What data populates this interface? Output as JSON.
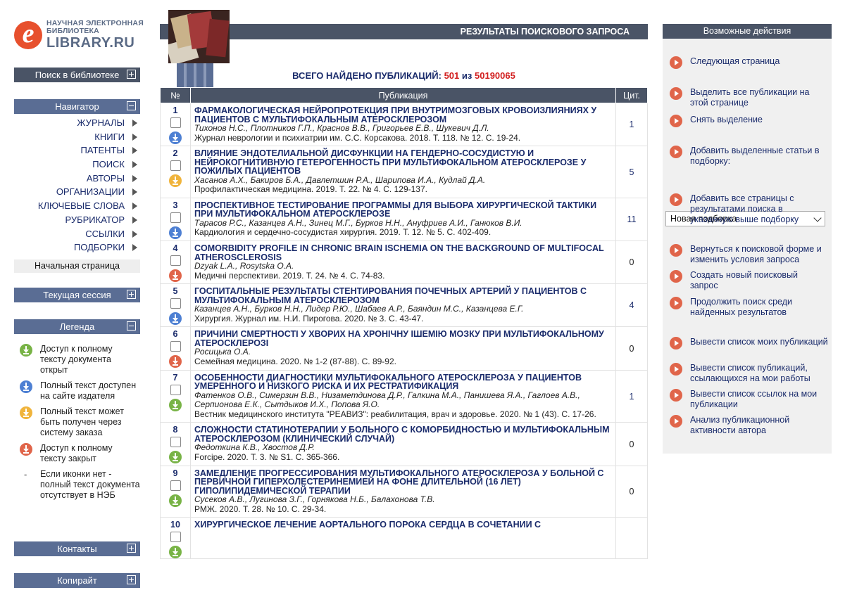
{
  "logo": {
    "line1": "НАУЧНАЯ ЭЛЕКТРОННАЯ",
    "line2": "БИБЛИОТЕКА",
    "brand": "LIBRARY.RU",
    "letter": "e"
  },
  "sidebar": {
    "search": "Поиск в библиотеке",
    "navigator": "Навигатор",
    "nav_items": [
      "ЖУРНАЛЫ",
      "КНИГИ",
      "ПАТЕНТЫ",
      "ПОИСК",
      "АВТОРЫ",
      "ОРГАНИЗАЦИИ",
      "КЛЮЧЕВЫЕ СЛОВА",
      "РУБРИКАТОР",
      "ССЫЛКИ",
      "ПОДБОРКИ"
    ],
    "home": "Начальная страница",
    "session": "Текущая сессия",
    "legend_title": "Легенда",
    "legend": [
      {
        "icon": "green-download-icon",
        "text": "Доступ к полному тексту документа открыт"
      },
      {
        "icon": "blue-download-icon",
        "text": "Полный текст доступен на сайте издателя"
      },
      {
        "icon": "yellow-download-icon",
        "text": "Полный текст может быть получен через систему заказа"
      },
      {
        "icon": "red-download-icon",
        "text": "Доступ к полному тексту закрыт"
      },
      {
        "icon": "dash",
        "text": "Если иконки нет - полный текст документа отсутствует в НЭБ",
        "mark": "-"
      }
    ],
    "contacts": "Контакты",
    "copyright": "Копирайт"
  },
  "main": {
    "header": "РЕЗУЛЬТАТЫ ПОИСКОВОГО ЗАПРОСА",
    "total_label": "ВСЕГО НАЙДЕНО ПУБЛИКАЦИЙ:",
    "total_found": "501",
    "of": "из",
    "total_all": "50190065",
    "columns": {
      "num": "№",
      "pub": "Публикация",
      "cit": "Цит."
    },
    "rows": [
      {
        "num": "1",
        "icon": "b",
        "title": "ФАРМАКОЛОГИЧЕСКАЯ НЕЙРОПРОТЕКЦИЯ ПРИ ВНУТРИМОЗГОВЫХ КРОВОИЗЛИЯНИЯХ У ПАЦИЕНТОВ С МУЛЬТИФОКАЛЬНЫМ АТЕРОСКЛЕРОЗОМ",
        "authors": "Тихонов Н.С., Плотников Г.П., Краснов В.В., Григорьев Е.В., Шукевич Д.Л.",
        "source": "Журнал неврологии и психиатрии им. С.С. Корсакова. 2018. Т. 118. № 12. С. 19-24.",
        "cit": "1"
      },
      {
        "num": "2",
        "icon": "y",
        "title": "ВЛИЯНИЕ ЭНДОТЕЛИАЛЬНОЙ ДИСФУНКЦИИ НА ГЕНДЕРНО-СОСУДИСТУЮ И НЕЙРОКОГНИТИВНУЮ ГЕТЕРОГЕННОСТЬ ПРИ МУЛЬТИФОКАЛЬНОМ АТЕРОСКЛЕРОЗЕ У ПОЖИЛЫХ ПАЦИЕНТОВ",
        "authors": "Хасанов А.Х., Бакиров Б.А., Давлетшин Р.А., Шарипова И.А., Кудлай Д.А.",
        "source": "Профилактическая медицина. 2019. Т. 22. № 4. С. 129-137.",
        "cit": "5"
      },
      {
        "num": "3",
        "icon": "b",
        "title": "ПРОСПЕКТИВНОЕ ТЕСТИРОВАНИЕ ПРОГРАММЫ ДЛЯ ВЫБОРА ХИРУРГИЧЕСКОЙ ТАКТИКИ ПРИ МУЛЬТИФОКАЛЬНОМ АТЕРОСКЛЕРОЗЕ",
        "authors": "Тарасов Р.С., Казанцев А.Н., Зинец М.Г., Бурков Н.Н., Ануфриев А.И., Ганюков В.И.",
        "source": "Кардиология и сердечно-сосудистая хирургия. 2019. Т. 12. № 5. С. 402-409.",
        "cit": "11"
      },
      {
        "num": "4",
        "icon": "r",
        "title": "COMORBIDITY PROFILE IN CHRONIC BRAIN ISCHEMIA ON THE BACKGROUND OF MULTIFOCAL ATHEROSCLEROSIS",
        "authors": "Dzyak L.A., Rosytska O.A.",
        "source": "Медичні перспективи. 2019. Т. 24. № 4. С. 74-83.",
        "cit": "0"
      },
      {
        "num": "5",
        "icon": "b",
        "title": "ГОСПИТАЛЬНЫЕ РЕЗУЛЬТАТЫ СТЕНТИРОВАНИЯ ПОЧЕЧНЫХ АРТЕРИЙ У ПАЦИЕНТОВ С МУЛЬТИФОКАЛЬНЫМ АТЕРОСКЛЕРОЗОМ",
        "authors": "Казанцев А.Н., Бурков Н.Н., Лидер Р.Ю., Шабаев А.Р., Баяндин М.С., Казанцева Е.Г.",
        "source": "Хирургия. Журнал им. Н.И. Пирогова. 2020. № 3. С. 43-47.",
        "cit": "4"
      },
      {
        "num": "6",
        "icon": "r",
        "title": "ПРИЧИНИ СМЕРТНОСТІ У ХВОРИХ НА ХРОНІЧНУ ІШЕМІЮ МОЗКУ ПРИ МУЛЬТИФОКАЛЬНОМУ АТЕРОСКЛЕРОЗІ",
        "authors": "Росицька О.А.",
        "source": "Семейная медицина. 2020. № 1-2 (87-88). С. 89-92.",
        "cit": "0"
      },
      {
        "num": "7",
        "icon": "g",
        "title": "ОСОБЕННОСТИ ДИАГНОСТИКИ МУЛЬТИФОКАЛЬНОГО АТЕРОСКЛЕРОЗА У ПАЦИЕНТОВ УМЕРЕННОГО И НИЗКОГО РИСКА И ИХ РЕСТРАТИФИКАЦИЯ",
        "authors": "Фатенков О.В., Симерзин В.В., Низаметдинова Д.Р., Галкина М.А., Панишева Я.А., Гаглоев А.В., Серпионова Е.К., Сытдыков И.Х., Попова Я.О.",
        "source": "Вестник медицинского института \"РЕАВИЗ\": реабилитация, врач и здоровье. 2020. № 1 (43). С. 17-26.",
        "cit": "1"
      },
      {
        "num": "8",
        "icon": "g",
        "title": "СЛОЖНОСТИ СТАТИНОТЕРАПИИ У БОЛЬНОГО С КОМОРБИДНОСТЬЮ И МУЛЬТИФОКАЛЬНЫМ АТЕРОСКЛЕРОЗОМ (КЛИНИЧЕСКИЙ СЛУЧАЙ)",
        "authors": "Федоткина К.В., Хвостов Д.Р.",
        "source": "Forcipe. 2020. Т. 3. № S1. С. 365-366.",
        "cit": "0"
      },
      {
        "num": "9",
        "icon": "g",
        "title": "ЗАМЕДЛЕНИЕ ПРОГРЕССИРОВАНИЯ МУЛЬТИФОКАЛЬНОГО АТЕРОСКЛЕРОЗА У БОЛЬНОЙ С ПЕРВИЧНОЙ ГИПЕРХОЛЕСТЕРИНЕМИЕЙ НА ФОНЕ ДЛИТЕЛЬНОЙ (16 ЛЕТ) ГИПОЛИПИДЕМИЧЕСКОЙ ТЕРАПИИ",
        "authors": "Сусеков А.В., Лугинова З.Г., Горнякова Н.Б., Балахонова Т.В.",
        "source": "РМЖ. 2020. Т. 28. № 10. С. 29-34.",
        "cit": "0"
      },
      {
        "num": "10",
        "icon": "g",
        "title": "ХИРУРГИЧЕСКОЕ ЛЕЧЕНИЕ АОРТАЛЬНОГО ПОРОКА СЕРДЦА В СОЧЕТАНИИ С",
        "authors": "",
        "source": "",
        "cit": ""
      }
    ]
  },
  "actions": {
    "title": "Возможные действия",
    "items": [
      "Следующая страница",
      "Выделить все публикации на этой странице",
      "Снять выделение",
      "Добавить выделенные статьи в подборку:",
      "Добавить все страницы с результатами поиска в указанную выше подборку",
      "Вернуться к поисковой форме и изменить условия запроса",
      "Создать новый поисковый запрос",
      "Продолжить поиск среди найденных результатов",
      "Вывести список моих публикаций",
      "Вывести список публикаций, ссылающихся на мои работы",
      "Вывести список ссылок на мои публикации",
      "Анализ публикационной активности автора"
    ],
    "collection_select": "Новая подборка"
  },
  "colors": {
    "header": "#4a5466",
    "nav_header": "#5a6d94",
    "link": "#1a2b6b",
    "accent_red": "#d21f1f",
    "action_arrow": "#e0654a"
  }
}
